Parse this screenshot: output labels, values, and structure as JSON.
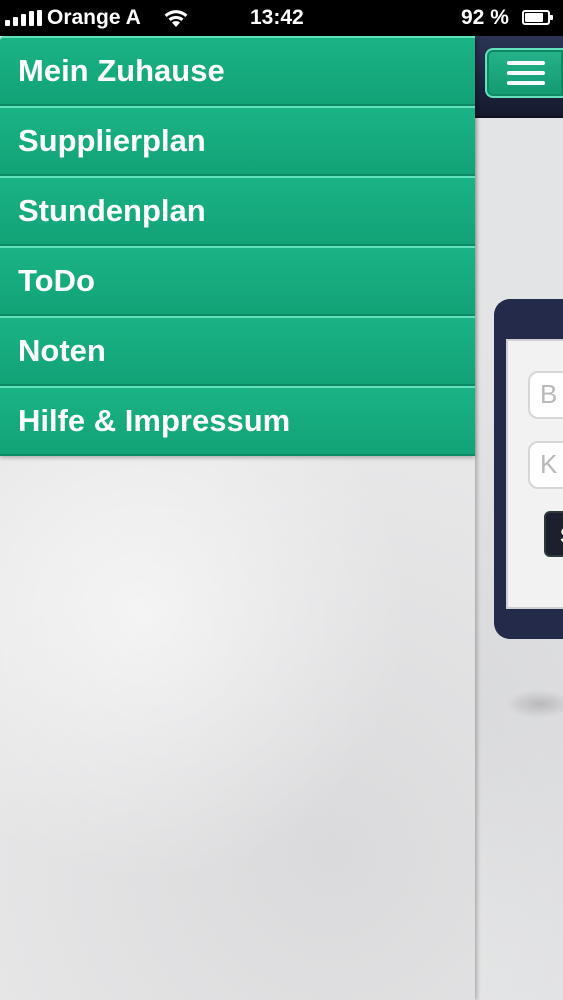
{
  "status_bar": {
    "carrier": "Orange A",
    "time": "13:42",
    "battery_percent": "92 %",
    "battery_level": 0.92,
    "icons": [
      "signal-bars-icon",
      "wifi-icon",
      "battery-icon"
    ]
  },
  "side_menu": {
    "items": [
      {
        "label": "Mein Zuhause"
      },
      {
        "label": "Supplierplan"
      },
      {
        "label": "Stundenplan"
      },
      {
        "label": "ToDo"
      },
      {
        "label": "Noten"
      },
      {
        "label": "Hilfe & Impressum"
      }
    ]
  },
  "header": {
    "menu_button_icon": "hamburger-menu-icon"
  },
  "login_form": {
    "username_placeholder": "B",
    "password_placeholder": "K",
    "submit_label": "S"
  },
  "colors": {
    "menu_green": "#12a277",
    "menu_highlight": "#5fe2bb",
    "header_navy": "#1f2740",
    "background_gray": "#e3e4e5"
  }
}
